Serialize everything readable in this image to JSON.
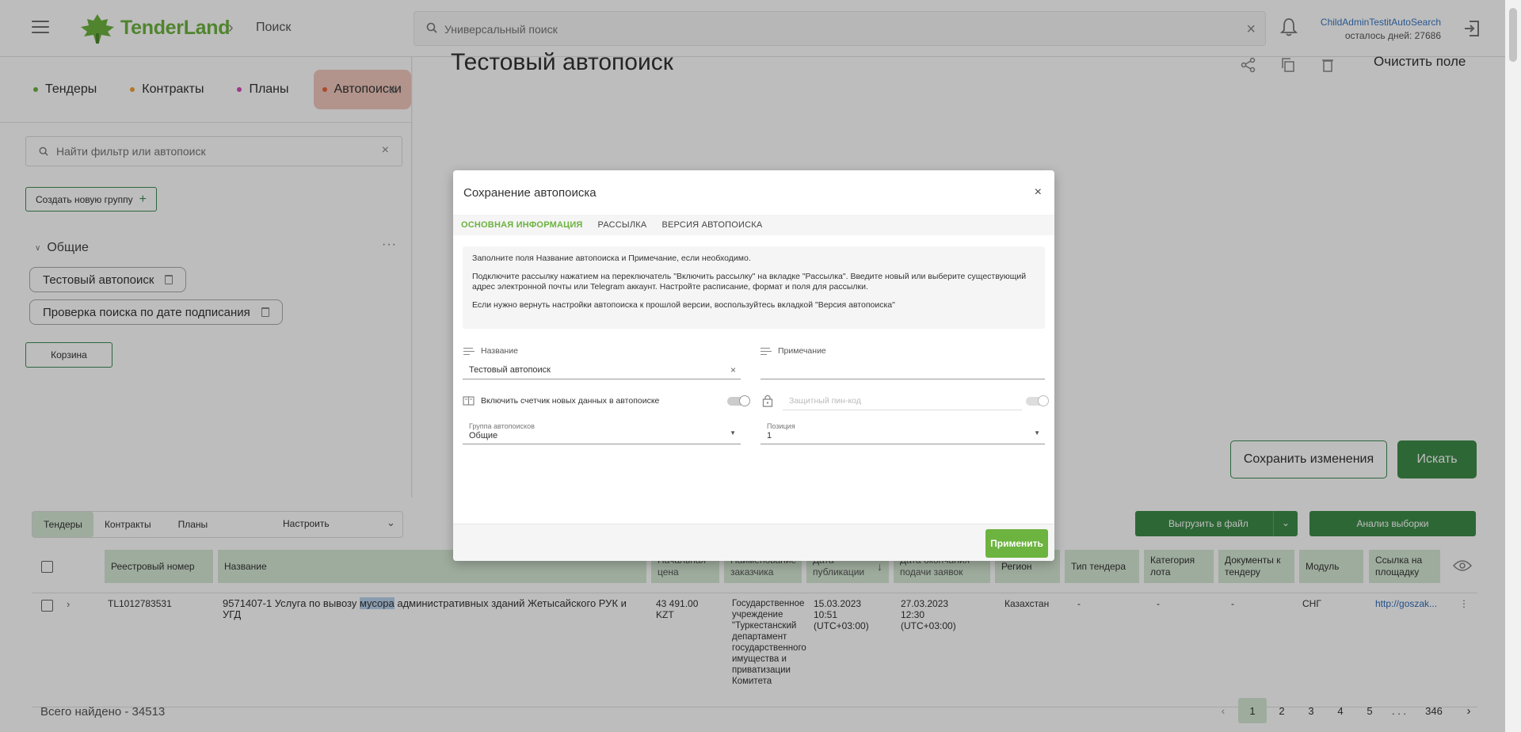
{
  "header": {
    "logo_text": "TenderLand",
    "breadcrumb": "Поиск",
    "search_placeholder": "Универсальный поиск",
    "user_name": "ChildAdminTestitAutoSearch",
    "days_left": "осталось дней: 27686"
  },
  "left": {
    "tabs": [
      {
        "label": "Тендеры",
        "dot": "#6cb33f"
      },
      {
        "label": "Контракты",
        "dot": "#f0a23b"
      },
      {
        "label": "Планы",
        "dot": "#d64bb8"
      },
      {
        "label": "Автопоиски",
        "dot": "#e8643a"
      }
    ],
    "filter_search_placeholder": "Найти фильтр или автопоиск",
    "create_group_label": "Создать новую группу",
    "group_name": "Общие",
    "autosearches": [
      "Тестовый автопоиск",
      "Проверка поиска по дате подписания"
    ],
    "basket_label": "Корзина"
  },
  "work": {
    "title": "Тестовый автопоиск",
    "clear_label": "Очистить поле",
    "save_changes_label": "Сохранить изменения",
    "search_label": "Искать"
  },
  "results": {
    "tabs": [
      "Тендеры",
      "Контракты",
      "Планы"
    ],
    "configure_label": "Настроить",
    "export_label": "Выгрузить в файл",
    "analysis_label": "Анализ выборки",
    "columns": [
      "Реестровый номер",
      "Название",
      "Начальная цена",
      "Наименование заказчика",
      "Дата публикации",
      "Дата окончания подачи заявок",
      "Регион",
      "Тип тендера",
      "Категория лота",
      "Документы к тендеру",
      "Модуль",
      "Ссылка на площадку"
    ],
    "row": {
      "number": "TL1012783531",
      "name_before": "9571407-1 Услуга по вывозу ",
      "name_highlight": "мусора",
      "name_after": " административных зданий Жетысайского РУК и УГД",
      "price": "43 491.00 KZT",
      "customer": "Государственное учреждение \"Туркестанский департамент государственного имущества и приватизации Комитета",
      "published": "15.03.2023 10:51 (UTC+03:00)",
      "deadline": "27.03.2023 12:30 (UTC+03:00)",
      "region": "Казахстан",
      "type": "-",
      "category": "-",
      "docs": "-",
      "module": "СНГ",
      "link": "http://goszak..."
    },
    "total": "Всего найдено - 34513",
    "pages": [
      "1",
      "2",
      "3",
      "4",
      "5",
      ". . .",
      "346"
    ]
  },
  "modal": {
    "title": "Сохранение автопоиска",
    "tabs": [
      "ОСНОВНАЯ ИНФОРМАЦИЯ",
      "РАССЫЛКА",
      "ВЕРСИЯ АВТОПОИСКА"
    ],
    "info": [
      "Заполните поля Название автопоиска и Примечание, если необходимо.",
      "Подключите рассылку нажатием на переключатель \"Включить рассылку\" на вкладке \"Рассылка\". Введите новый или выберите существующий адрес электронной почты или Telegram аккаунт. Настройте расписание, формат и поля для рассылки.",
      "Если нужно вернуть настройки автопоиска к прошлой версии, воспользуйтесь вкладкой \"Версия автопоиска\""
    ],
    "name_label": "Название",
    "name_value": "Тестовый автопоиск",
    "note_label": "Примечание",
    "counter_label": "Включить счетчик новых данных в автопоиске",
    "pin_placeholder": "Защитный пин-код",
    "group_label": "Группа автопоисков",
    "group_value": "Общие",
    "position_label": "Позиция",
    "position_value": "1",
    "apply_label": "Применить"
  }
}
